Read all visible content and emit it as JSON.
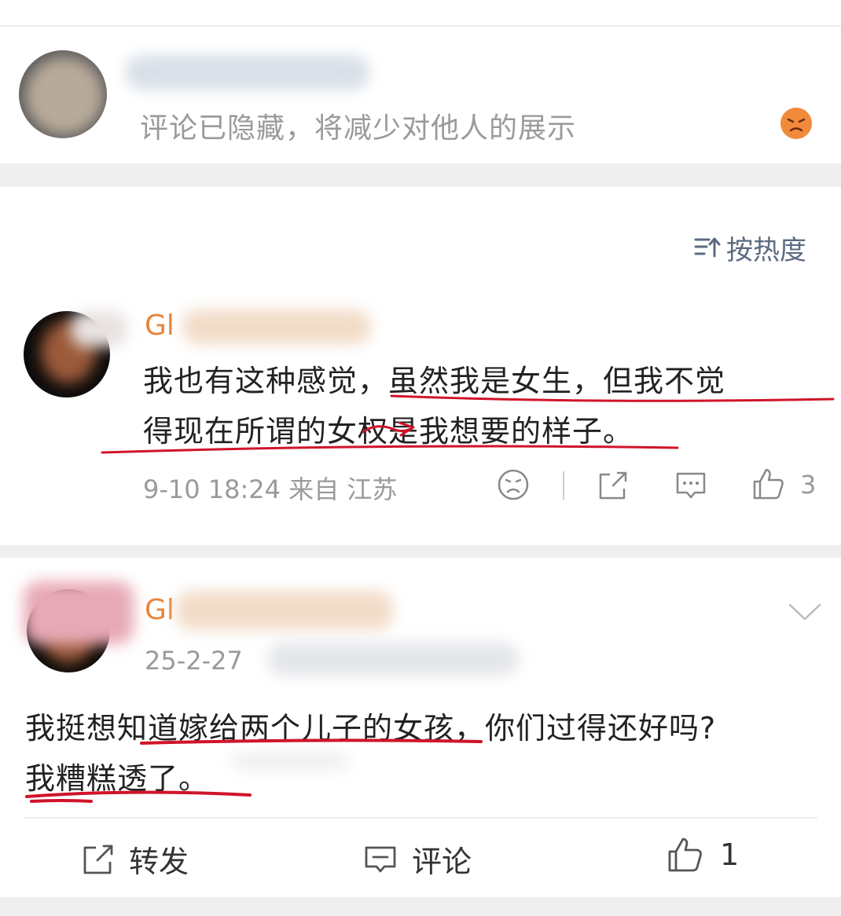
{
  "hidden_comment": {
    "notice": "评论已隐藏，将减少对他人的展示"
  },
  "sort": {
    "label": "按热度"
  },
  "comment1": {
    "name_visible": "Gl",
    "text_line1": "我也有这种感觉，虽然我是女生，但我不觉",
    "text_line2": "得现在所谓的女权是我想要的样子。",
    "meta": "9-10 18:24 来自 江苏",
    "like_count": "3"
  },
  "post": {
    "name_visible": "Gl",
    "date": "25-2-27",
    "text_line1": "我挺想知道嫁给两个儿子的女孩，你们过得还好吗?",
    "text_line2": "我糟糕透了。"
  },
  "actions": {
    "repost": "转发",
    "comment": "评论",
    "like_count": "1"
  },
  "colors": {
    "username": "#e8853a",
    "annotation": "#d0142a",
    "sort": "#5b6b80",
    "angry_face": "#f28a3c"
  }
}
